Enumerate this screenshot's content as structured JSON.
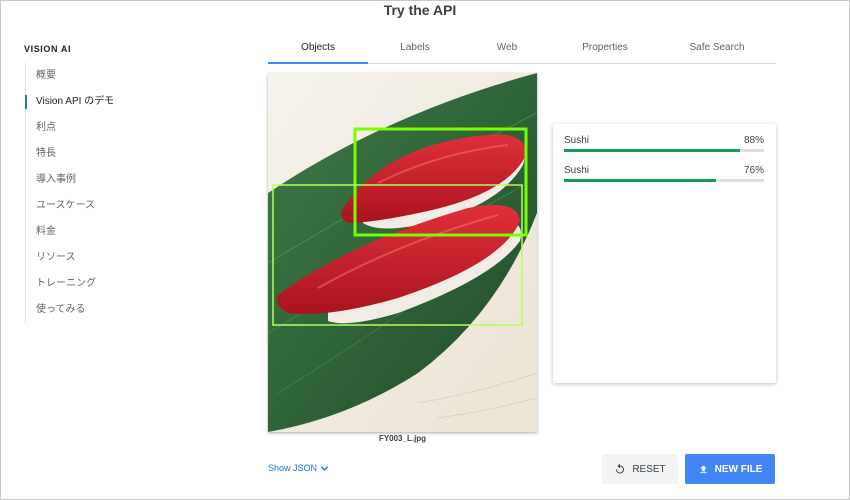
{
  "sidebar": {
    "brand": "VISION AI",
    "items": [
      {
        "label": "概要",
        "active": false
      },
      {
        "label": "Vision API のデモ",
        "active": true
      },
      {
        "label": "利点",
        "active": false
      },
      {
        "label": "特長",
        "active": false
      },
      {
        "label": "導入事例",
        "active": false
      },
      {
        "label": "ユースケース",
        "active": false
      },
      {
        "label": "料金",
        "active": false
      },
      {
        "label": "リソース",
        "active": false
      },
      {
        "label": "トレーニング",
        "active": false
      },
      {
        "label": "使ってみる",
        "active": false
      }
    ]
  },
  "header": {
    "title": "Try the API",
    "tabs": [
      {
        "label": "Objects",
        "active": true
      },
      {
        "label": "Labels",
        "active": false
      },
      {
        "label": "Web",
        "active": false
      },
      {
        "label": "Properties",
        "active": false
      },
      {
        "label": "Safe Search",
        "active": false
      }
    ]
  },
  "image": {
    "filename": "FY003_L.jpg",
    "box_color": "#76ff03"
  },
  "results": [
    {
      "label": "Sushi",
      "percent_text": "88%",
      "score": 0.88
    },
    {
      "label": "Sushi",
      "percent_text": "76%",
      "score": 0.76
    }
  ],
  "controls": {
    "show_json": "Show JSON",
    "reset": "RESET",
    "new_file": "NEW FILE"
  },
  "colors": {
    "accent": "#4285f4",
    "bar": "#0f9d58",
    "link": "#1a73e8"
  },
  "icons": {
    "reset": "reset-icon",
    "upload": "upload-icon",
    "chevron": "chevron-down-icon"
  }
}
